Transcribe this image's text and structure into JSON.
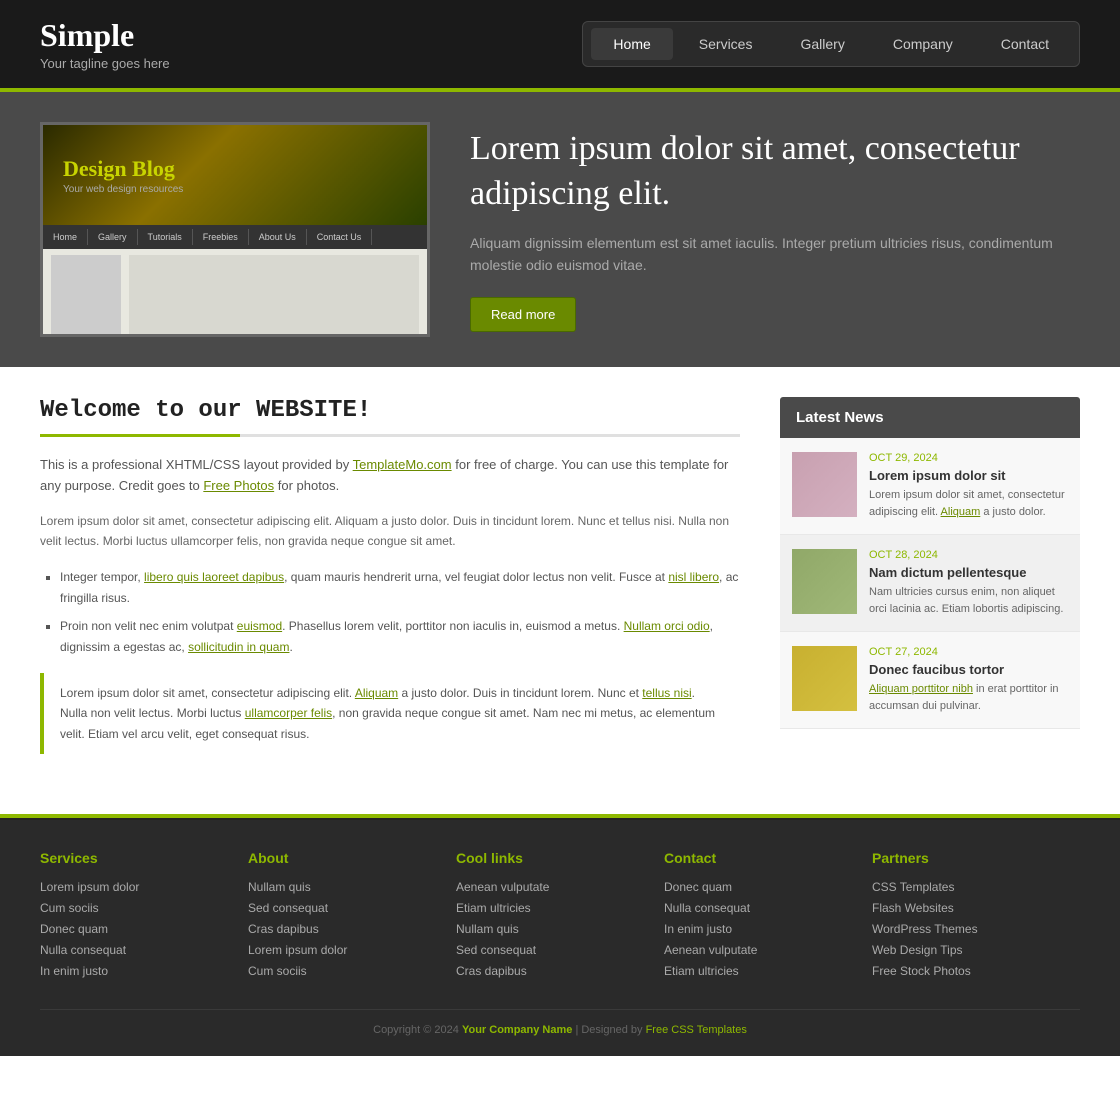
{
  "site": {
    "title": "Simple",
    "tagline": "Your tagline goes here"
  },
  "nav": {
    "items": [
      {
        "label": "Home",
        "active": true
      },
      {
        "label": "Services",
        "active": false
      },
      {
        "label": "Gallery",
        "active": false
      },
      {
        "label": "Company",
        "active": false
      },
      {
        "label": "Contact",
        "active": false
      }
    ]
  },
  "hero": {
    "blog_title": "Design Blog",
    "blog_subtitle": "Your web design resources",
    "nav_items": [
      "Home",
      "Gallery",
      "Tutorials",
      "Freebies",
      "About Us",
      "Contact Us"
    ],
    "heading": "Lorem ipsum dolor sit amet, consectetur adipiscing elit.",
    "body": "Aliquam dignissim elementum est sit amet iaculis. Integer pretium ultricies risus, condimentum molestie odio euismod vitae.",
    "read_more": "Read more"
  },
  "content": {
    "heading": "Welcome to our WEBSITE!",
    "intro": "This is a professional XHTML/CSS layout provided by TemplateMo.com for free of charge. You can use this template for any purpose. Credit goes to Free Photos for photos.",
    "body1": "Lorem ipsum dolor sit amet, consectetur adipiscing elit. Aliquam a justo dolor. Duis in tincidunt lorem. Nunc et tellus nisi. Nulla non velit lectus. Morbi luctus ullamcorper felis, non gravida neque congue sit amet.",
    "list_item1": "Integer tempor, libero quis laoreet dapibus, quam mauris hendrerit urna, vel feugiat dolor lectus non velit. Fusce at nisl libero, ac fringilla risus.",
    "list_item2": "Proin non velit nec enim volutpat euismod. Phasellus lorem velit, porttitor non iaculis in, euismod a metus. Nullam orci odio, dignissim a egestas ac, sollicitudin in quam.",
    "blockquote": "Lorem ipsum dolor sit amet, consectetur adipiscing elit. Aliquam a justo dolor. Duis in tincidunt lorem. Nunc et tellus nisi. Nulla non velit lectus. Morbi luctus ullamcorper felis, non gravida neque congue sit amet. Nam nec mi metus, ac elementum velit. Etiam vel arcu velit, eget consequat risus."
  },
  "news": {
    "heading": "Latest News",
    "items": [
      {
        "date": "OCT 29, 2024",
        "title": "Lorem ipsum dolor sit",
        "excerpt": "Lorem ipsum dolor sit amet, consectetur adipiscing elit. Aliquam a justo dolor.",
        "thumb_class": "t1"
      },
      {
        "date": "OCT 28, 2024",
        "title": "Nam dictum pellentesque",
        "excerpt": "Nam ultricies cursus enim, non aliquet orci lacinia ac. Etiam lobortis adipiscing.",
        "thumb_class": "t2"
      },
      {
        "date": "OCT 27, 2024",
        "title": "Donec faucibus tortor",
        "excerpt": "Aliquam porttitor nibh in erat porttitor in accumsan dui pulvinar.",
        "thumb_class": "t3"
      }
    ]
  },
  "footer": {
    "cols": [
      {
        "heading": "Services",
        "links": [
          "Lorem ipsum dolor",
          "Cum sociis",
          "Donec quam",
          "Nulla consequat",
          "In enim justo"
        ]
      },
      {
        "heading": "About",
        "links": [
          "Nullam quis",
          "Sed consequat",
          "Cras dapibus",
          "Lorem ipsum dolor",
          "Cum sociis"
        ]
      },
      {
        "heading": "Cool links",
        "links": [
          "Aenean vulputate",
          "Etiam ultricies",
          "Nullam quis",
          "Sed consequat",
          "Cras dapibus"
        ]
      },
      {
        "heading": "Contact",
        "links": [
          "Donec quam",
          "Nulla consequat",
          "In enim justo",
          "Aenean vulputate",
          "Etiam ultricies"
        ]
      },
      {
        "heading": "Partners",
        "links": [
          "CSS Templates",
          "Flash Websites",
          "WordPress Themes",
          "Web Design Tips",
          "Free Stock Photos"
        ]
      }
    ],
    "copyright": "Copyright © 2024",
    "company": "Your Company Name",
    "designed_by": "Designed by",
    "designer": "Free CSS Templates"
  }
}
